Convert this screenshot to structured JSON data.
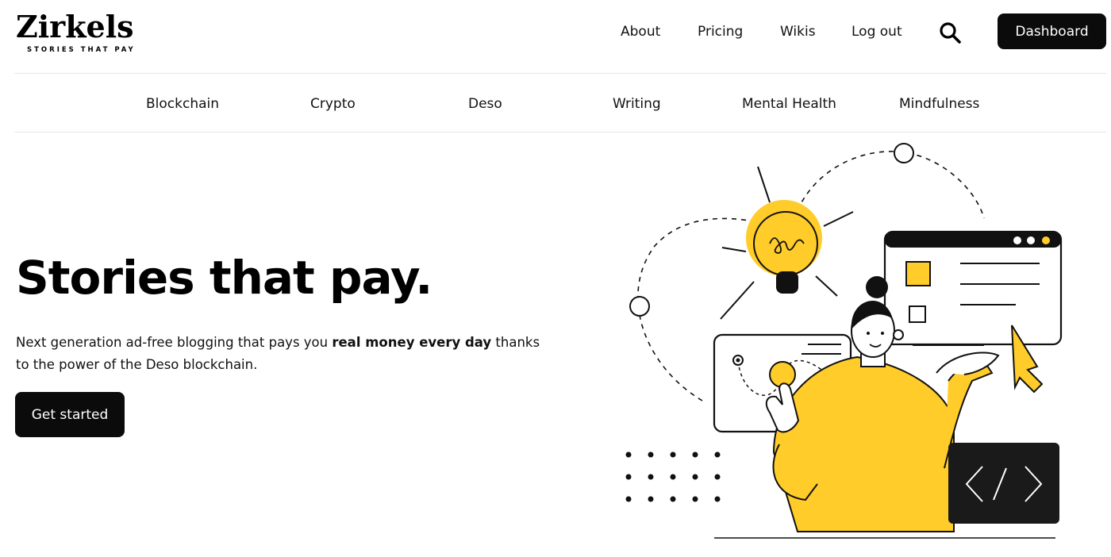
{
  "brand": {
    "name": "Zirkels",
    "tagline": "STORIES THAT PAY",
    "accent": "#FFCC29"
  },
  "top_nav": {
    "items": [
      {
        "label": "About"
      },
      {
        "label": "Pricing"
      },
      {
        "label": "Wikis"
      },
      {
        "label": "Log out"
      }
    ],
    "search_icon": "search-icon",
    "dashboard_label": "Dashboard"
  },
  "category_nav": {
    "items": [
      {
        "label": "Blockchain"
      },
      {
        "label": "Crypto"
      },
      {
        "label": "Deso"
      },
      {
        "label": "Writing"
      },
      {
        "label": "Mental Health"
      },
      {
        "label": "Mindfulness"
      }
    ]
  },
  "hero": {
    "title": "Stories that pay.",
    "desc_prefix": "Next generation ad-free blogging that pays you ",
    "desc_bold": "real money every day",
    "desc_suffix": " thanks to the power of the Deso blockchain.",
    "cta_label": "Get started"
  },
  "illustration": {
    "description_icon": "person-with-lightbulb-illustration",
    "colors": {
      "yellow": "#FFCC29",
      "dark": "#111111"
    }
  }
}
